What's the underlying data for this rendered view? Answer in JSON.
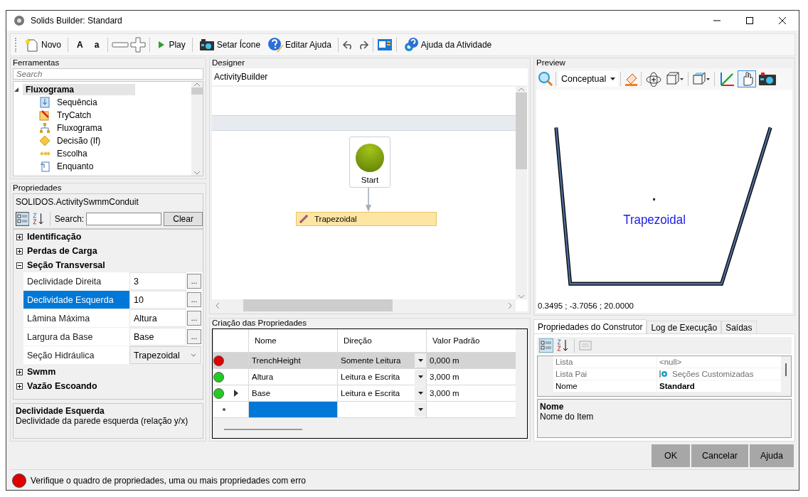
{
  "window": {
    "title": "Solids Builder: Standard"
  },
  "toolbar": {
    "new": "Novo",
    "bold": "A",
    "small": "a",
    "play": "Play",
    "set_icon": "Setar Ícone",
    "edit_help": "Editar Ajuda",
    "activity_help": "Ajuda da Atividade"
  },
  "tools": {
    "title": "Ferramentas",
    "search": {
      "placeholder": "Search"
    },
    "tree": [
      {
        "label": "Fluxograma",
        "expanded": true,
        "selected": true,
        "children": [
          {
            "label": "Sequência",
            "selected": false
          },
          {
            "label": "TryCatch",
            "selected": false
          },
          {
            "label": "Fluxograma",
            "selected": false
          },
          {
            "label": "Decisão (If)",
            "selected": false
          },
          {
            "label": "Escolha",
            "selected": false
          },
          {
            "label": "Enquanto",
            "selected": false
          }
        ]
      }
    ]
  },
  "properties": {
    "title": "Propriedades",
    "object": "SOLIDOS.ActivitySwmmConduit",
    "search_label": "Search:",
    "clear": "Clear",
    "categories": [
      {
        "label": "Identificação",
        "expanded": false
      },
      {
        "label": "Perdas de Carga",
        "expanded": false
      },
      {
        "label": "Seção Transversal",
        "expanded": true,
        "rows": [
          {
            "name": "Declividade Direita",
            "value": "3",
            "kind": "text",
            "button": "...",
            "selected": false
          },
          {
            "name": "Declividade Esquerda",
            "value": "10",
            "kind": "text",
            "button": "...",
            "selected": true
          },
          {
            "name": "Lâmina Máxima",
            "value": "Altura",
            "kind": "text",
            "button": "...",
            "selected": false
          },
          {
            "name": "Largura da Base",
            "value": "Base",
            "kind": "text",
            "button": "...",
            "selected": false
          },
          {
            "name": "Seção Hidráulica",
            "value": "Trapezoidal",
            "kind": "dropdown",
            "selected": false
          }
        ]
      },
      {
        "label": "Swmm",
        "expanded": false
      },
      {
        "label": "Vazão Escoando",
        "expanded": false
      }
    ],
    "description": {
      "title": "Declividade Esquerda",
      "text": "Declividade da parede esquerda (relação y/x)"
    }
  },
  "designer": {
    "title": "Designer",
    "breadcrumb": "ActivityBuilder",
    "start": "Start",
    "activity": "Trapezoidal"
  },
  "creation": {
    "title": "Criação das Propriedades",
    "columns": [
      "Nome",
      "Direção",
      "Valor Padrão"
    ],
    "rows": [
      {
        "color": "#e00000",
        "name": "TrenchHeight",
        "direction": "Somente Leitura",
        "value": "0,000 m",
        "selected": true,
        "current": false
      },
      {
        "color": "#22cc22",
        "name": "Altura",
        "direction": "Leitura e Escrita",
        "value": "3,000 m",
        "selected": false,
        "current": false
      },
      {
        "color": "#22cc22",
        "name": "Base",
        "direction": "Leitura e Escrita",
        "value": "3,000 m",
        "selected": false,
        "current": true
      }
    ]
  },
  "preview": {
    "title": "Preview",
    "view_mode": "Conceptual",
    "tools": [
      {
        "selected": false
      },
      {
        "selected": false
      },
      {
        "selected": false
      },
      {
        "selected": false
      },
      {
        "selected": true
      },
      {
        "selected": false
      }
    ],
    "shape_label": "Trapezoidal",
    "coordinates": "0.3495 ; -3.7056 ; 20.0000"
  },
  "builder": {
    "tabs": [
      {
        "label": "Propriedades do Construtor",
        "selected": true
      },
      {
        "label": "Log de Execução",
        "selected": false
      },
      {
        "label": "Saídas",
        "selected": false
      }
    ],
    "rows": [
      {
        "name": "Lista",
        "value": "<null>",
        "kind": "null"
      },
      {
        "name": "Lista Pai",
        "value": "Seções Customizadas",
        "kind": "link"
      },
      {
        "name": "Nome",
        "value": "Standard",
        "kind": "bold"
      }
    ],
    "description": {
      "title": "Nome",
      "text": "Nome do Item"
    }
  },
  "buttons": [
    "OK",
    "Cancelar",
    "Ajuda"
  ],
  "status": {
    "color": "#e00000",
    "text": "Verifique o quadro de propriedades, uma ou mais propriedades com erro"
  }
}
